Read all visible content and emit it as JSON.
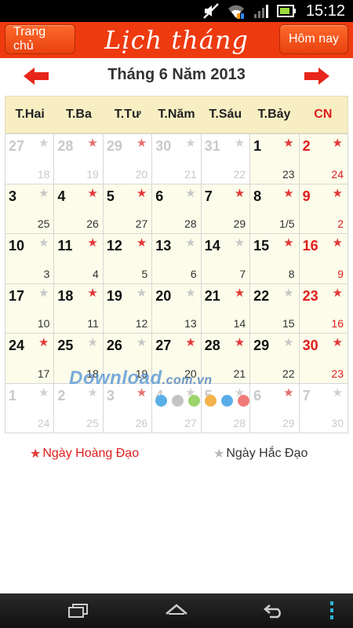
{
  "status_bar": {
    "time": "15:12"
  },
  "header": {
    "home_button": "Trang chủ",
    "title": "Lịch tháng",
    "today_button": "Hôm nay"
  },
  "month_nav": {
    "title": "Tháng 6 Năm 2013"
  },
  "weekdays": [
    "T.Hai",
    "T.Ba",
    "T.Tư",
    "T.Năm",
    "T.Sáu",
    "T.Bảy",
    "CN"
  ],
  "calendar": {
    "cells": [
      {
        "day": "27",
        "lunar": "18",
        "good": false,
        "out": true
      },
      {
        "day": "28",
        "lunar": "19",
        "good": true,
        "out": true
      },
      {
        "day": "29",
        "lunar": "20",
        "good": true,
        "out": true
      },
      {
        "day": "30",
        "lunar": "21",
        "good": false,
        "out": true
      },
      {
        "day": "31",
        "lunar": "22",
        "good": false,
        "out": true
      },
      {
        "day": "1",
        "lunar": "23",
        "good": true,
        "out": false
      },
      {
        "day": "2",
        "lunar": "24",
        "good": true,
        "out": false
      },
      {
        "day": "3",
        "lunar": "25",
        "good": false,
        "out": false
      },
      {
        "day": "4",
        "lunar": "26",
        "good": true,
        "out": false
      },
      {
        "day": "5",
        "lunar": "27",
        "good": true,
        "out": false
      },
      {
        "day": "6",
        "lunar": "28",
        "good": false,
        "out": false
      },
      {
        "day": "7",
        "lunar": "29",
        "good": true,
        "out": false
      },
      {
        "day": "8",
        "lunar": "1/5",
        "good": true,
        "out": false
      },
      {
        "day": "9",
        "lunar": "2",
        "good": true,
        "out": false
      },
      {
        "day": "10",
        "lunar": "3",
        "good": false,
        "out": false
      },
      {
        "day": "11",
        "lunar": "4",
        "good": true,
        "out": false
      },
      {
        "day": "12",
        "lunar": "5",
        "good": true,
        "out": false
      },
      {
        "day": "13",
        "lunar": "6",
        "good": false,
        "out": false
      },
      {
        "day": "14",
        "lunar": "7",
        "good": false,
        "out": false
      },
      {
        "day": "15",
        "lunar": "8",
        "good": true,
        "out": false
      },
      {
        "day": "16",
        "lunar": "9",
        "good": true,
        "out": false
      },
      {
        "day": "17",
        "lunar": "10",
        "good": false,
        "out": false
      },
      {
        "day": "18",
        "lunar": "11",
        "good": true,
        "out": false
      },
      {
        "day": "19",
        "lunar": "12",
        "good": false,
        "out": false
      },
      {
        "day": "20",
        "lunar": "13",
        "good": false,
        "out": false
      },
      {
        "day": "21",
        "lunar": "14",
        "good": true,
        "out": false
      },
      {
        "day": "22",
        "lunar": "15",
        "good": false,
        "out": false
      },
      {
        "day": "23",
        "lunar": "16",
        "good": true,
        "out": false
      },
      {
        "day": "24",
        "lunar": "17",
        "good": true,
        "out": false
      },
      {
        "day": "25",
        "lunar": "18",
        "good": false,
        "out": false
      },
      {
        "day": "26",
        "lunar": "19",
        "good": false,
        "out": false
      },
      {
        "day": "27",
        "lunar": "20",
        "good": true,
        "out": false
      },
      {
        "day": "28",
        "lunar": "21",
        "good": true,
        "out": false
      },
      {
        "day": "29",
        "lunar": "22",
        "good": false,
        "out": false
      },
      {
        "day": "30",
        "lunar": "23",
        "good": true,
        "out": false
      },
      {
        "day": "1",
        "lunar": "24",
        "good": false,
        "out": true
      },
      {
        "day": "2",
        "lunar": "25",
        "good": false,
        "out": true
      },
      {
        "day": "3",
        "lunar": "26",
        "good": true,
        "out": true
      },
      {
        "day": "4",
        "lunar": "27",
        "good": false,
        "out": true
      },
      {
        "day": "5",
        "lunar": "28",
        "good": false,
        "out": true
      },
      {
        "day": "6",
        "lunar": "29",
        "good": true,
        "out": true
      },
      {
        "day": "7",
        "lunar": "30",
        "good": false,
        "out": true
      }
    ]
  },
  "watermark": {
    "brand": "Download",
    "suffix": ".com.vn"
  },
  "legend": {
    "good_label": "Ngày Hoàng Đạo",
    "bad_label": "Ngày Hắc Đạo"
  },
  "colors": {
    "header": "#ee3a0f",
    "sunday": "#e11d1d",
    "good_star": "#e23838",
    "bad_star": "#c8c8c8",
    "weekday_bg": "#f7efc3",
    "cell_bg": "#fcfcea",
    "watermark_dots": [
      "#5aaee8",
      "#c4c4c4",
      "#9ad46a",
      "#f3b24b",
      "#5aaee8",
      "#f07a7a"
    ]
  },
  "icons": {
    "status": [
      "mute-icon",
      "wifi-icon",
      "signal-icon",
      "battery-icon"
    ],
    "nav": [
      "recent-apps-icon",
      "home-icon",
      "back-icon",
      "menu-icon"
    ],
    "month": [
      "prev-arrow-icon",
      "next-arrow-icon"
    ]
  }
}
